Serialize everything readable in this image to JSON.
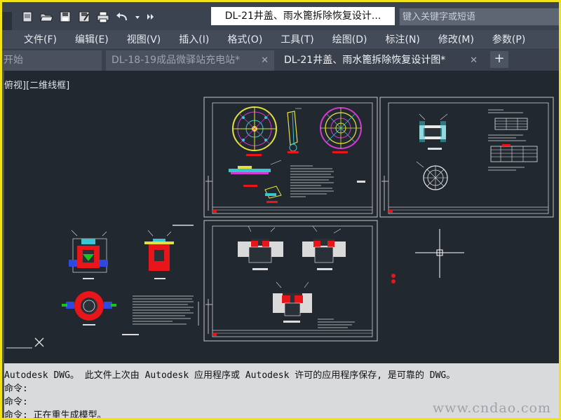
{
  "quick_access": {
    "icons": [
      "new-icon",
      "open-icon",
      "save-icon",
      "save-as-icon",
      "print-icon",
      "undo-icon",
      "dropdown-icon",
      "more-icon"
    ]
  },
  "document_title": "DL-21井盖、雨水篦拆除恢复设计...",
  "search": {
    "placeholder": "键入关键字或短语"
  },
  "menu": {
    "items": [
      "文件(F)",
      "编辑(E)",
      "视图(V)",
      "插入(I)",
      "格式(O)",
      "工具(T)",
      "绘图(D)",
      "标注(N)",
      "修改(M)",
      "参数(P)"
    ]
  },
  "tabs": {
    "items": [
      {
        "label": "开始"
      },
      {
        "label": "DL-18-19成品微驿站充电站*"
      },
      {
        "label": "DL-21井盖、雨水篦拆除恢复设计图*"
      }
    ],
    "close_glyph": "✕",
    "add_glyph": "+"
  },
  "viewport": {
    "label": "俯视][二维线框]"
  },
  "command": {
    "lines": [
      "Autodesk DWG。  此文件上次由 Autodesk 应用程序或 Autodesk 许可的应用程序保存, 是可靠的 DWG。",
      "命令:",
      "命令:",
      "命令: 正在重生成模型。"
    ]
  },
  "watermark": "www.cndao.com",
  "colors": {
    "canvas": "#212830",
    "title_bar": "#3b4350",
    "frame": "#f2e21a",
    "drawing_red": "#e8161b",
    "drawing_yellow": "#e3e13d",
    "drawing_cyan": "#39c6d4",
    "drawing_magenta": "#d33ad0"
  }
}
